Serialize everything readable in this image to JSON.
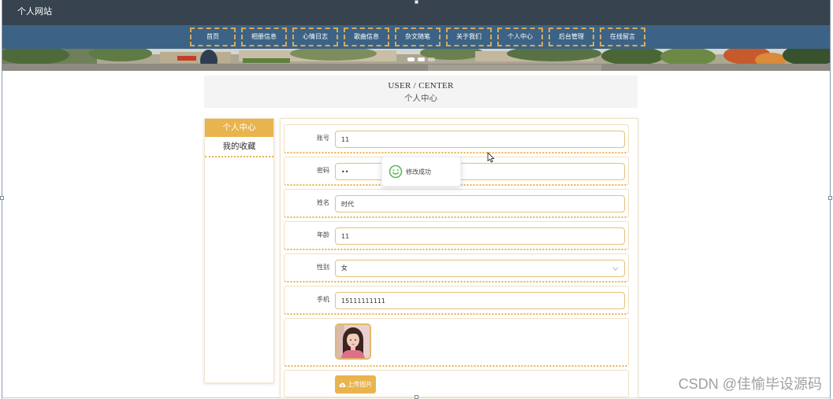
{
  "theme": {
    "top_bar": "#37434f",
    "nav_bar": "#3c6386",
    "nav_border": "#d9a954",
    "accent": "#e9b44d",
    "input_border": "#e4c17e",
    "toast_icon": "#5cb85c",
    "watermark": "#a0a0a0"
  },
  "site": {
    "title": "个人网站"
  },
  "nav": {
    "items": [
      {
        "label": "首页"
      },
      {
        "label": "相册信息"
      },
      {
        "label": "心情日志"
      },
      {
        "label": "歌曲信息"
      },
      {
        "label": "杂文随笔"
      },
      {
        "label": "关于我们"
      },
      {
        "label": "个人中心"
      },
      {
        "label": "后台管理"
      },
      {
        "label": "在线留言"
      }
    ]
  },
  "page_header": {
    "title_en": "USER / CENTER",
    "title_cn": "个人中心"
  },
  "sidebar": {
    "items": [
      {
        "label": "个人中心",
        "active": true
      },
      {
        "label": "我的收藏",
        "active": false
      }
    ]
  },
  "profile_form": {
    "fields": [
      {
        "label": "账号",
        "value": "11"
      },
      {
        "label": "密码",
        "value": "••"
      },
      {
        "label": "姓名",
        "value": "时代"
      },
      {
        "label": "年龄",
        "value": "11"
      },
      {
        "label": "性别",
        "value": "女"
      },
      {
        "label": "手机",
        "value": "15111111111"
      }
    ],
    "upload_button": {
      "label": "上传图片",
      "icon": "cloud-upload-icon"
    }
  },
  "toast": {
    "message": "修改成功",
    "icon": "smile-icon"
  },
  "watermark": {
    "text": "CSDN @佳愉毕设源码"
  }
}
